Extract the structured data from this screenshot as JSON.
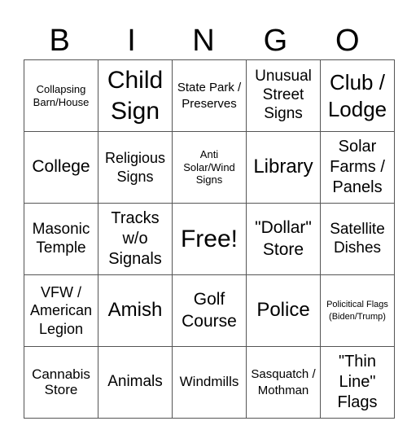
{
  "header": [
    "B",
    "I",
    "N",
    "G",
    "O"
  ],
  "rows": [
    [
      "Collapsing Barn/House",
      "Child Sign",
      "State Park / Preserves",
      "Unusual Street Signs",
      "Club / Lodge"
    ],
    [
      "College",
      "Religious Signs",
      "Anti Solar/Wind Signs",
      "Library",
      "Solar Farms / Panels"
    ],
    [
      "Masonic Temple",
      "Tracks w/o Signals",
      "Free!",
      "\"Dollar\" Store",
      "Satellite Dishes"
    ],
    [
      "VFW / American Legion",
      "Amish",
      "Golf Course",
      "Police",
      "Policitical Flags (Biden/Trump)"
    ],
    [
      "Cannabis Store",
      "Animals",
      "Windmills",
      "Sasquatch / Mothman",
      "\"Thin Line\" Flags"
    ]
  ]
}
